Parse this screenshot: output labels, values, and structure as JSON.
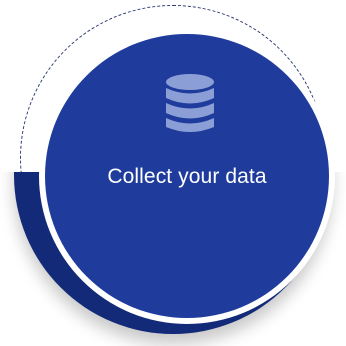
{
  "step": {
    "label": "Collect your data",
    "icon": "database-icon"
  },
  "colors": {
    "disc": "#1f3c9d",
    "band": "#132a78",
    "ring": "#ffffff",
    "dashed_ring": "#2b3a73",
    "icon": "#8b9fd6",
    "text": "#ffffff"
  }
}
